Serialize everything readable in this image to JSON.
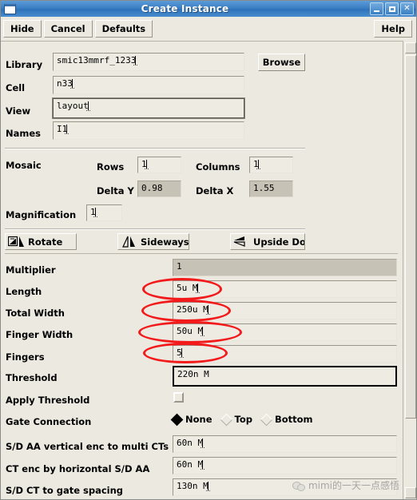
{
  "window": {
    "title": "Create Instance",
    "icon": "window-icon",
    "buttons": {
      "minimize": "_",
      "maximize": "□",
      "close": "✕"
    }
  },
  "actionbar": {
    "hide": "Hide",
    "cancel": "Cancel",
    "defaults": "Defaults",
    "help": "Help"
  },
  "top_form": {
    "library": {
      "label": "Library",
      "value": "smic13mmrf_1233"
    },
    "cell": {
      "label": "Cell",
      "value": "n33"
    },
    "view": {
      "label": "View",
      "value": "layout"
    },
    "names": {
      "label": "Names",
      "value": "I1"
    },
    "browse": "Browse"
  },
  "mosaic": {
    "label": "Mosaic",
    "rows": {
      "label": "Rows",
      "value": "1"
    },
    "columns": {
      "label": "Columns",
      "value": "1"
    },
    "delta_y": {
      "label": "Delta Y",
      "value": "0.98"
    },
    "delta_x": {
      "label": "Delta X",
      "value": "1.55"
    },
    "magnification": {
      "label": "Magnification",
      "value": "1"
    }
  },
  "transform": {
    "rotate": "Rotate",
    "sideways": "Sideways",
    "upside_down": "Upside Dow"
  },
  "params": [
    {
      "label": "Multiplier",
      "value": "1",
      "state": "readonly",
      "annotated": false
    },
    {
      "label": "Length",
      "value": "5u M",
      "state": "normal",
      "annotated": true
    },
    {
      "label": "Total Width",
      "value": "250u M",
      "state": "normal",
      "annotated": true
    },
    {
      "label": "Finger Width",
      "value": "50u M",
      "state": "normal",
      "annotated": true
    },
    {
      "label": "Fingers",
      "value": "5",
      "state": "normal",
      "annotated": true
    },
    {
      "label": "Threshold",
      "value": "220n M",
      "state": "focused",
      "annotated": false
    }
  ],
  "apply_threshold": {
    "label": "Apply Threshold",
    "checked": false
  },
  "gate_connection": {
    "label": "Gate Connection",
    "selected": "None",
    "options": [
      "None",
      "Top",
      "Bottom"
    ]
  },
  "bottom_params": [
    {
      "label": "S/D AA vertical enc to multi CTs",
      "value": "60n M"
    },
    {
      "label": "CT enc by horizontal S/D AA",
      "value": "60n M"
    },
    {
      "label": "S/D CT to gate spacing",
      "value": "130n M"
    }
  ],
  "watermark": {
    "text": "mimi的一天一点感悟",
    "logo": "wechat-logo"
  },
  "colors": {
    "titlebar": "#3b7fc4",
    "face": "#ece9e0",
    "field": "#eeebe3",
    "readonly_field": "#c6c2b6",
    "annotation": "#f21a1a"
  }
}
